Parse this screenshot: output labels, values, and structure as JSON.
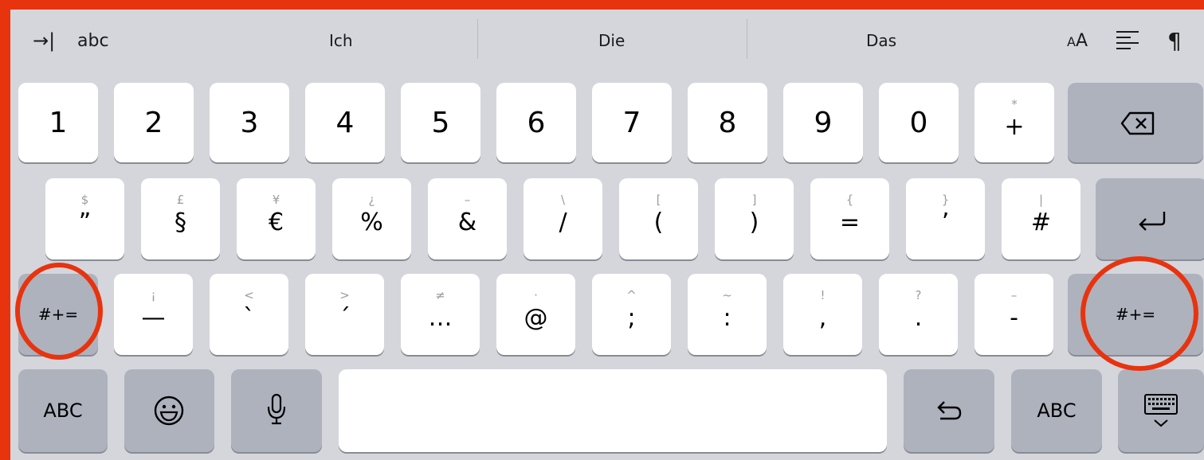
{
  "top_bar": {
    "tab_arrow": "→|",
    "abc": "abc",
    "predictions": [
      "Ich",
      "Die",
      "Das"
    ],
    "text_size": "AA"
  },
  "row1": [
    {
      "main": "1"
    },
    {
      "main": "2"
    },
    {
      "main": "3"
    },
    {
      "main": "4"
    },
    {
      "main": "5"
    },
    {
      "main": "6"
    },
    {
      "main": "7"
    },
    {
      "main": "8"
    },
    {
      "main": "9"
    },
    {
      "main": "0"
    },
    {
      "alt": "*",
      "main": "+"
    }
  ],
  "row2": [
    {
      "alt": "$",
      "main": "”"
    },
    {
      "alt": "£",
      "main": "§"
    },
    {
      "alt": "¥",
      "main": "€"
    },
    {
      "alt": "¿",
      "main": "%"
    },
    {
      "alt": "–",
      "main": "&"
    },
    {
      "alt": "\\",
      "main": "/"
    },
    {
      "alt": "[",
      "main": "("
    },
    {
      "alt": "]",
      "main": ")"
    },
    {
      "alt": "{",
      "main": "="
    },
    {
      "alt": "}",
      "main": "’"
    },
    {
      "alt": "|",
      "main": "#"
    }
  ],
  "row3": [
    {
      "alt": "¡",
      "main": "—"
    },
    {
      "alt": "<",
      "main": "`"
    },
    {
      "alt": ">",
      "main": "´"
    },
    {
      "alt": "≠",
      "main": "…"
    },
    {
      "alt": "·",
      "main": "@"
    },
    {
      "alt": "^",
      "main": ";"
    },
    {
      "alt": "~",
      "main": ":"
    },
    {
      "alt": "!",
      "main": ","
    },
    {
      "alt": "?",
      "main": "."
    },
    {
      "alt": "–",
      "main": "-"
    }
  ],
  "keys": {
    "symbols_left": "#+=",
    "symbols_right": "#+=",
    "abc_left": "ABC",
    "abc_right": "ABC"
  },
  "icons": [
    "tab-arrow-icon",
    "text-size-icon",
    "align-icon",
    "pilcrow-icon",
    "delete-icon",
    "return-icon",
    "emoji-icon",
    "mic-icon",
    "undo-icon",
    "keyboard-dismiss-icon"
  ],
  "colors": {
    "keyboard_bg": "#d4d6dc",
    "key": "#ffffff",
    "dark_key": "#adb2bd",
    "annotation": "#e8330f"
  }
}
